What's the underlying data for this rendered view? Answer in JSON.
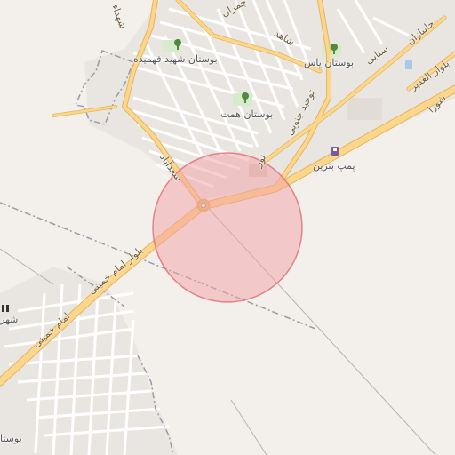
{
  "map": {
    "labels": {
      "park_fahimeh": "بوستان شهید فهمیده",
      "park_yas": "بوستان یاس",
      "park_hemmat": "بوستان همت",
      "fuel_station": "پمپ بنزین",
      "park_sw": "بوستا",
      "place_w": "شهر"
    },
    "road_labels": {
      "imam_khomeini": "بلوار امام خمینی",
      "imam_khomeini_2": "امام خمینی",
      "saadabad": "سعدآباد",
      "tohid_south": "توحید جنوبی",
      "ghadir": "بلوار الغدیر",
      "shahid": "شهداء",
      "chamran": "چمران",
      "nour": "نور",
      "shari": "شاهد",
      "janbazan": "جانبازان",
      "setaei": "ستایی",
      "shora": "شورا"
    },
    "marker": {
      "fill": "#f4a0a6",
      "stroke": "#e06c75"
    },
    "colors": {
      "background": "#f3f0eb",
      "major_road": "#fcd68a",
      "major_road_casing": "#e8b45a",
      "minor_road": "#ffffff",
      "minor_road_casing": "#cfcac2",
      "boundary": "#9a9aa6",
      "park": "#cde8c2"
    }
  }
}
